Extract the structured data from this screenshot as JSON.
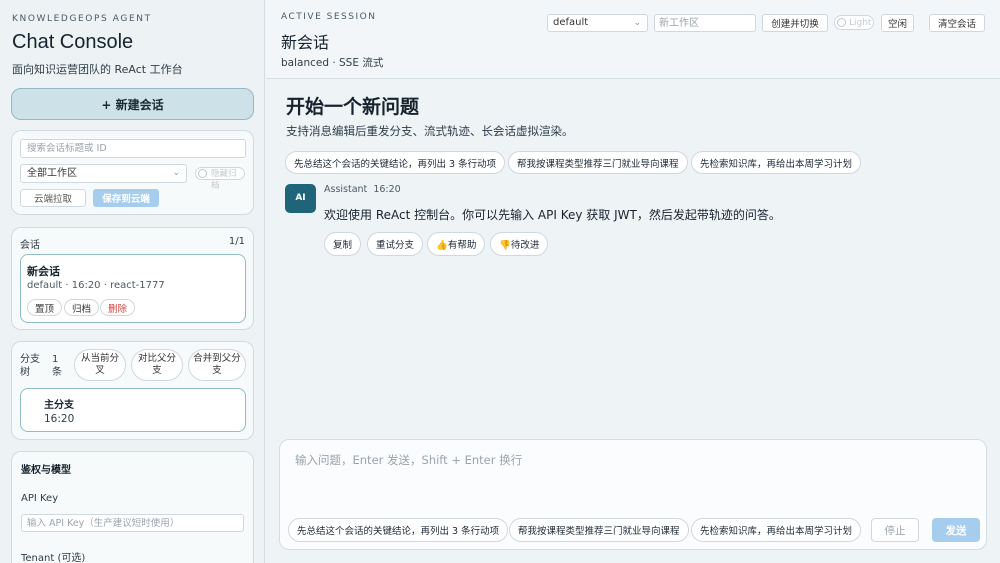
{
  "sidebar": {
    "kicker": "KNOWLEDGEOPS AGENT",
    "title": "Chat Console",
    "subtitle": "面向知识运营团队的 ReAct 工作台",
    "new_chat_label": "+ 新建会话",
    "search": {
      "placeholder": "搜索会话标题或 ID"
    },
    "workspace_select": {
      "value": "全部工作区"
    },
    "archived_toggle_label": "隐藏归档",
    "cloud_pull_label": "云端拉取",
    "cloud_save_label": "保存到云端",
    "sessions": {
      "label": "会话",
      "count": "1/1",
      "items": [
        {
          "title": "新会话",
          "meta": "default · 16:20 · react-1777",
          "pin": "置顶",
          "archive": "归档",
          "delete": "删除"
        }
      ]
    },
    "branches": {
      "label": "分支树",
      "count": "1 条",
      "fork_label": "从当前分叉",
      "compare_label": "对比父分支",
      "merge_label": "合并到父分支",
      "main": {
        "title": "主分支",
        "time": "16:20"
      }
    },
    "auth": {
      "title": "鉴权与模型",
      "api_key_label": "API Key",
      "api_key_placeholder": "输入 API Key（生产建议短时使用）",
      "tenant_label": "Tenant (可选)"
    }
  },
  "header": {
    "kicker": "ACTIVE SESSION",
    "title": "新会话",
    "subtitle": "balanced · SSE 流式",
    "profile_select": "default",
    "new_workspace_placeholder": "新工作区",
    "create_switch_label": "创建并切换",
    "theme_label": "Light",
    "idle_label": "空闲",
    "clear_label": "清空会话"
  },
  "chat": {
    "title": "开始一个新问题",
    "subtitle": "支持消息编辑后重发分支、流式轨迹、长会话虚拟渲染。",
    "suggestions": [
      "先总结这个会话的关键结论，再列出 3 条行动项",
      "帮我按课程类型推荐三门就业导向课程",
      "先检索知识库，再给出本周学习计划"
    ],
    "message": {
      "avatar": "AI",
      "role": "Assistant",
      "time": "16:20",
      "text": "欢迎使用 ReAct 控制台。你可以先输入 API Key 获取 JWT，然后发起带轨迹的问答。",
      "actions": {
        "copy": "复制",
        "retry": "重试分支",
        "helpful": "👍有帮助",
        "improve": "👎待改进"
      }
    }
  },
  "composer": {
    "placeholder": "输入问题，Enter 发送，Shift + Enter 换行",
    "stop_label": "停止",
    "send_label": "发送"
  },
  "colors": {
    "accent": "#1f6478",
    "primary_button": "#a7cdee",
    "danger": "#d0433f",
    "new_chat_bg": "#cde2e8"
  }
}
